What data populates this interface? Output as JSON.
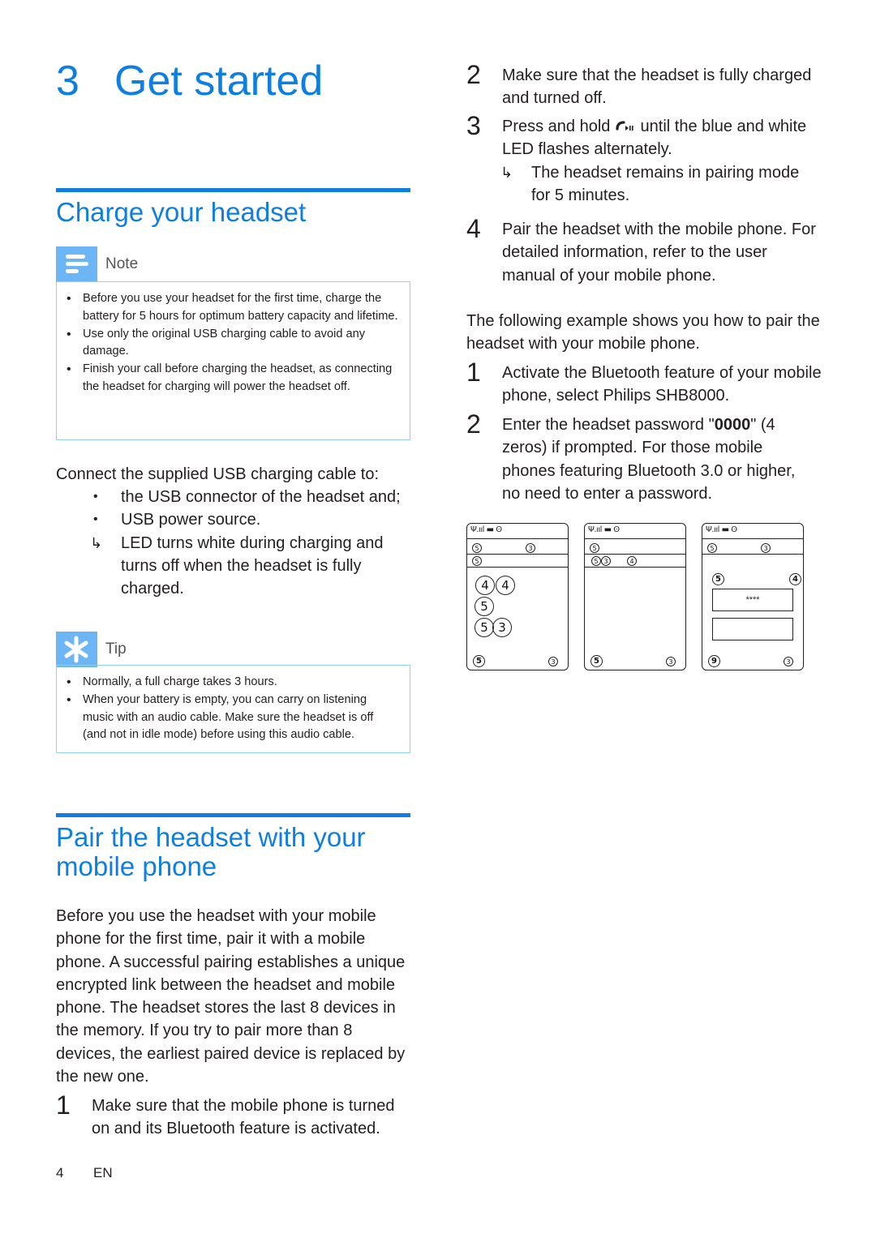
{
  "chapter": {
    "number": "3",
    "title": "Get started"
  },
  "charge_section": {
    "title": "Charge your headset",
    "note": {
      "label": "Note",
      "icon": "note-icon",
      "items": [
        "Before you use your headset for the first time, charge the battery for 5 hours for optimum battery capacity and lifetime.",
        "Use only the original USB charging cable to avoid any damage.",
        "Finish your call before charging the headset, as connecting the headset for charging will power the headset off."
      ]
    },
    "intro": "Connect the supplied USB charging cable to:",
    "bullets": [
      "the USB connector of the headset and;",
      "USB power source."
    ],
    "result": "LED turns white during charging and turns off when the headset is fully charged.",
    "tip": {
      "label": "Tip",
      "icon": "tip-icon",
      "items": [
        "Normally, a full charge takes 3 hours.",
        "When your battery is empty, you can carry on listening music with an audio cable. Make sure the headset is off (and not in idle mode) before using this audio cable."
      ]
    }
  },
  "pair_section": {
    "title": "Pair the headset with your mobile phone",
    "intro": "Before you use the headset with your mobile phone for the first time, pair it with a mobile phone. A successful pairing establishes a unique encrypted link between the headset and mobile phone. The headset stores the last 8 devices in the memory. If you try to pair more than 8 devices, the earliest paired device is replaced by the new one.",
    "steps": [
      {
        "n": "1",
        "text": "Make sure that the mobile phone is turned on and its Bluetooth feature is activated."
      },
      {
        "n": "2",
        "text": "Make sure that the headset is fully charged and turned off."
      },
      {
        "n": "3",
        "text_before": "Press and hold",
        "icon": "call-play-pause-icon",
        "text_after": "until the blue and white LED flashes alternately.",
        "result": "The headset remains in pairing mode for 5 minutes."
      },
      {
        "n": "4",
        "text": "Pair the headset with the mobile phone. For detailed information, refer to the user manual of your mobile phone."
      }
    ],
    "example_intro": "The following example shows you how to pair the headset with your mobile phone.",
    "example_steps": [
      {
        "n": "1",
        "text": "Activate the Bluetooth feature of your mobile phone, select Philips SHB8000."
      },
      {
        "n": "2",
        "text_before": "Enter the headset password \"",
        "password": "0000",
        "text_after": "\" (4 zeros) if prompted. For those mobile phones featuring Bluetooth 3.0 or higher, no need to enter a password."
      }
    ],
    "phones": {
      "status_bar": "Ψ.ııl ▬ ʘ",
      "screen1": {
        "row1_left": "5",
        "row1_right": "3",
        "row2_left": "5",
        "big": [
          "4",
          "4",
          "5",
          "5",
          "3"
        ],
        "soft_left": "5",
        "soft_right": "3"
      },
      "screen2": {
        "row1_left": "5",
        "row2": [
          "5",
          "3",
          "4"
        ],
        "soft_left": "5",
        "soft_right": "3"
      },
      "screen3": {
        "row1_left": "5",
        "row1_right": "3",
        "label_left": "5",
        "label_right": "4",
        "password_mask": "****",
        "soft_left": "9",
        "soft_right": "3"
      }
    }
  },
  "footer": {
    "page": "4",
    "lang": "EN"
  }
}
